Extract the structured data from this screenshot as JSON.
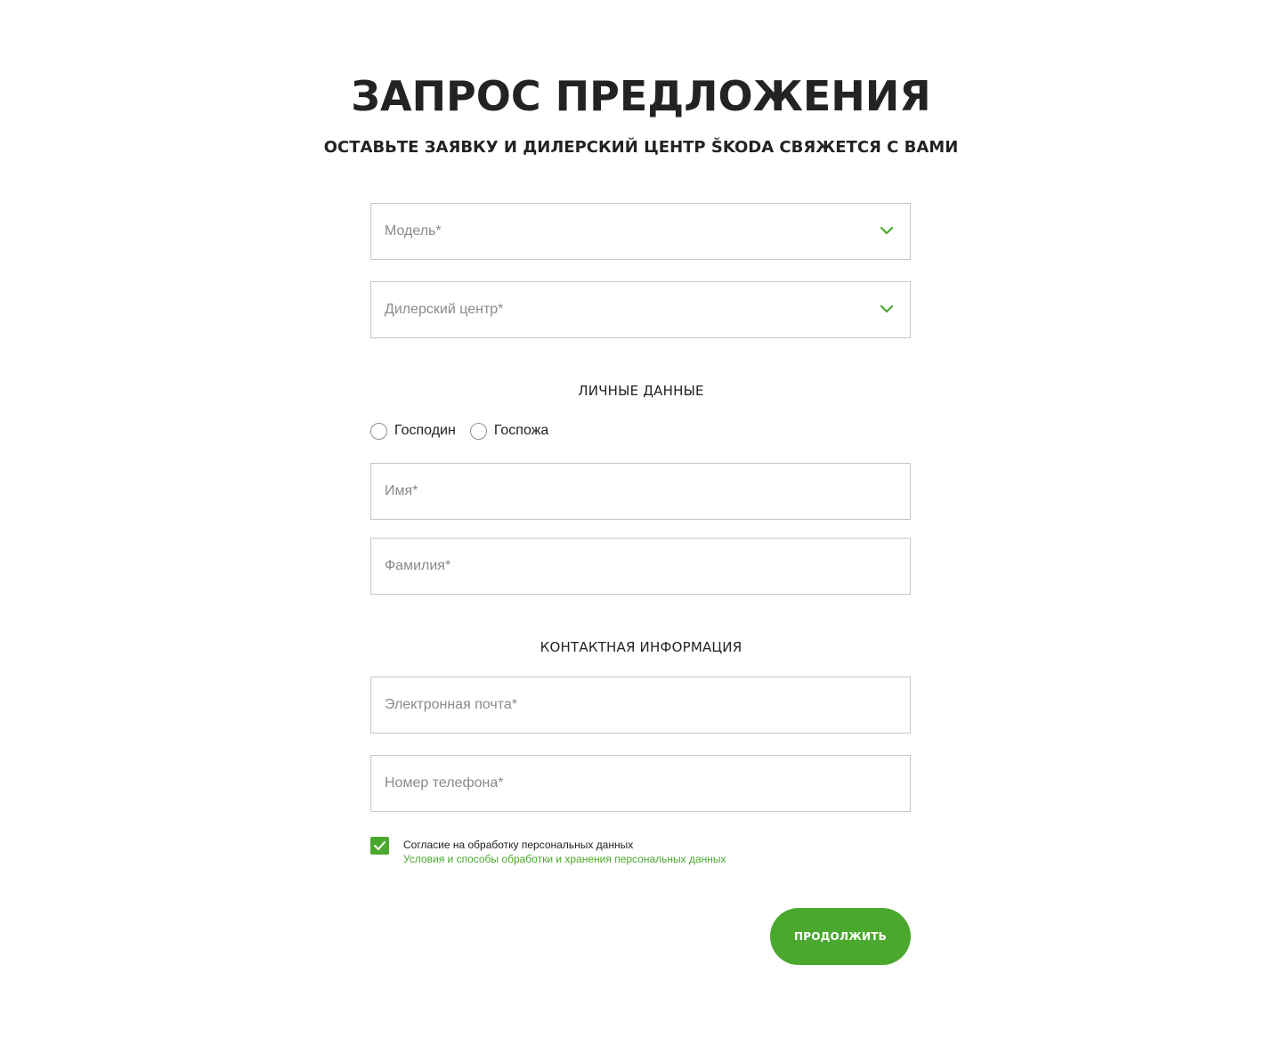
{
  "header": {
    "title": "ЗАПРОС ПРЕДЛОЖЕНИЯ",
    "subtitle": "ОСТАВЬТЕ ЗАЯВКУ И ДИЛЕРСКИЙ ЦЕНТР ŠKODA СВЯЖЕТСЯ С ВАМИ"
  },
  "form": {
    "model_select": {
      "placeholder": "Модель*",
      "icon": "chevron-down-icon"
    },
    "dealer_select": {
      "placeholder": "Дилерский центр*",
      "icon": "chevron-down-icon"
    },
    "personal": {
      "heading": "ЛИЧНЫЕ ДАННЫЕ",
      "salutation_options": [
        {
          "label": "Господин",
          "selected": false
        },
        {
          "label": "Госпожа",
          "selected": false
        }
      ],
      "first_name_placeholder": "Имя*",
      "last_name_placeholder": "Фамилия*"
    },
    "contact": {
      "heading": "КОНТАКТНАЯ ИНФОРМАЦИЯ",
      "email_placeholder": "Электронная почта*",
      "phone_placeholder": "Номер телефона*"
    },
    "consent": {
      "checked": true,
      "label": "Согласие на обработку персональных данных",
      "link": "Условия и способы обработки и хранения персональных данных"
    },
    "submit_label": "ПРОДОЛЖИТЬ"
  },
  "colors": {
    "accent": "#4ba82e",
    "text": "#222222",
    "placeholder": "#8a8a8a",
    "border": "#c6c6c6"
  }
}
